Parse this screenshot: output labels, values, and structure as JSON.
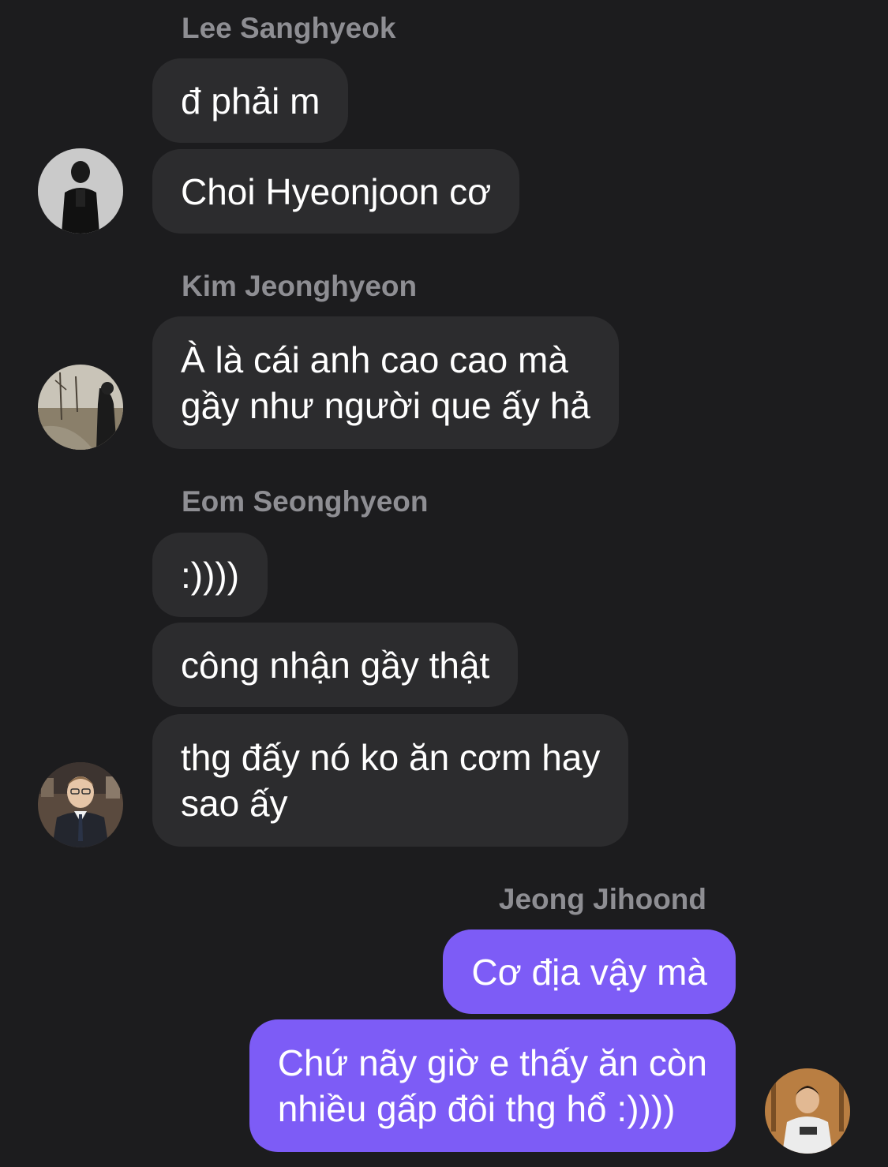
{
  "groups": [
    {
      "sender": "Lee Sanghyeok",
      "messages": [
        {
          "lines": [
            "đ phải m"
          ]
        },
        {
          "lines": [
            "Choi Hyeonjoon cơ"
          ]
        }
      ]
    },
    {
      "sender": "Kim Jeonghyeon",
      "messages": [
        {
          "lines": [
            "À là cái anh cao cao mà",
            "gầy như người que ấy hả"
          ]
        }
      ]
    },
    {
      "sender": "Eom Seonghyeon",
      "messages": [
        {
          "lines": [
            ":))))"
          ]
        },
        {
          "lines": [
            "công nhận gầy thật"
          ]
        },
        {
          "lines": [
            "thg đấy nó ko ăn cơm hay",
            "sao ấy"
          ]
        }
      ]
    },
    {
      "sender": "Jeong Jihoond",
      "outgoing": true,
      "messages": [
        {
          "lines": [
            "Cơ địa vậy mà"
          ]
        },
        {
          "lines": [
            "Chứ nãy giờ e thấy ăn còn",
            "nhiều gấp đôi thg hổ :))))"
          ]
        }
      ]
    }
  ],
  "colors": {
    "background": "#1c1c1e",
    "incoming_bubble": "#2c2c2e",
    "outgoing_bubble": "#7d5cf6",
    "sender_name": "#8e8e93",
    "message_text": "#ffffff"
  }
}
